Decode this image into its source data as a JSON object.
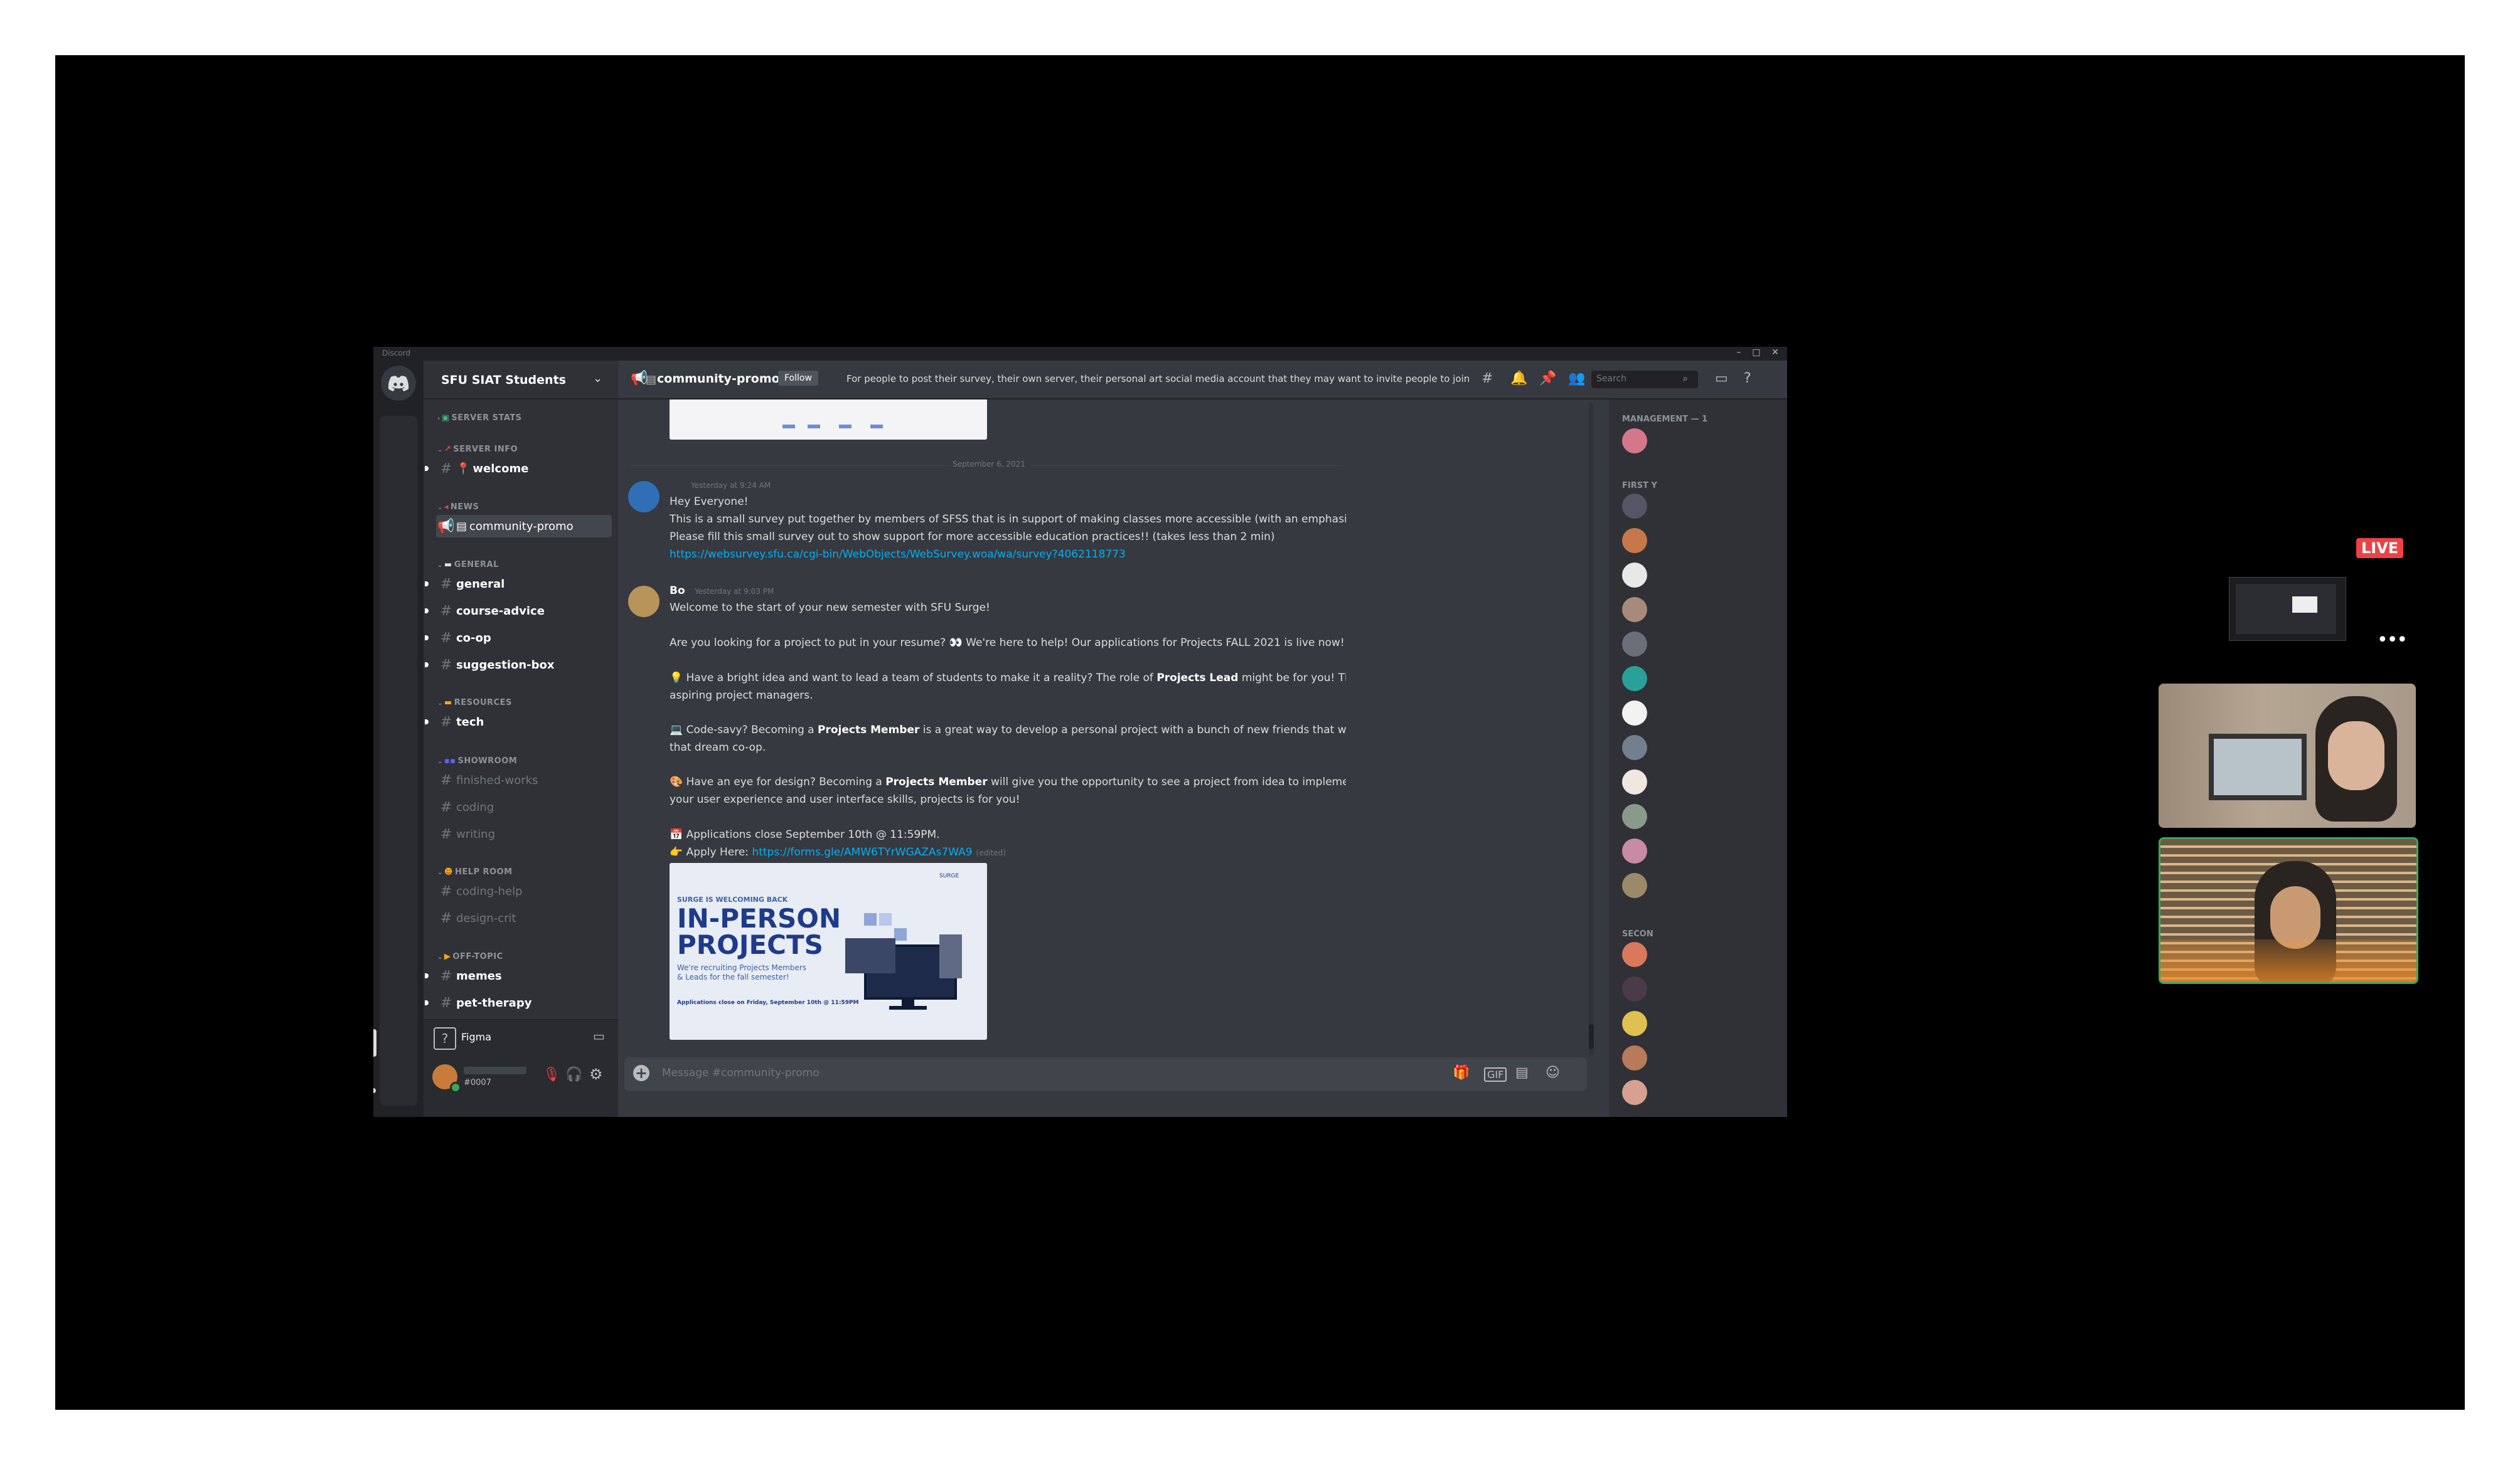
{
  "window": {
    "app_title": "Discord",
    "min": "–",
    "max": "□",
    "close": "✕"
  },
  "server": {
    "name": "SFU SIAT Students"
  },
  "categories": {
    "server_stats": "SERVER STATS",
    "server_info": "SERVER INFO",
    "news": "NEWS",
    "general": "GENERAL",
    "resources": "RESOURCES",
    "showroom": "SHOWROOM",
    "help_room": "HELP ROOM",
    "off_topic": "OFF-TOPIC"
  },
  "channels": {
    "welcome": "welcome",
    "community_promo": "community-promo",
    "general": "general",
    "course_advice": "course-advice",
    "co_op": "co-op",
    "suggestion_box": "suggestion-box",
    "tech": "tech",
    "finished_works": "finished-works",
    "coding": "coding",
    "writing": "writing",
    "coding_help": "coding-help",
    "design_crit": "design-crit",
    "memes": "memes",
    "pet_therapy": "pet-therapy"
  },
  "voice_bar": {
    "label": "Figma"
  },
  "user_bar": {
    "tag": "#0007"
  },
  "header": {
    "channel": "community-promo",
    "follow": "Follow",
    "topic": "For people to post their survey, their own server, their personal art social media account that they may want to invite people to join",
    "search_placeholder": "Search"
  },
  "messages": {
    "date_divider": "September 6, 2021",
    "m1": {
      "timestamp": "Yesterday at 9:24 AM",
      "line1": "Hey Everyone!",
      "line2": "This is a small survey put together by members of SFSS that is in support of making classes more accessible (with an emphasis on recorded lectures)",
      "line3": "Please fill this small survey out to show support for more accessible education practices!! (takes less than 2 min)",
      "link": "https://websurvey.sfu.ca/cgi-bin/WebObjects/WebSurvey.woa/wa/survey?4062118773"
    },
    "m2": {
      "author": "Bo",
      "timestamp": "Yesterday at 9:03 PM",
      "line1": "Welcome to the start of your new semester with SFU Surge!",
      "line2": "Are you looking for a project to put in your resume? 👀 We're here to help! Our applications for Projects FALL 2021 is live now!",
      "line3a": "💡 Have a bright idea and want to lead a team of students to make it a reality? The role of ",
      "line3b": "Projects Lead",
      "line3c": " might be for you! This role is great for business students, and",
      "line3d": "aspiring project managers.",
      "line4a": "💻 Code-savy? Becoming a ",
      "line4b": "Projects Member",
      "line4c": " is a great way to develop a personal project with a bunch of new friends that will boost your resume and help you land",
      "line4d": "that dream co-op.",
      "line5a": "🎨 Have an eye for design? Becoming a ",
      "line5b": "Projects Member",
      "line5c": " will give you the opportunity to see a project from idea to implementation. If you are looking to brush up on",
      "line5d": "your user experience and user interface skills, projects is for you!",
      "line6": "📅 Applications close September 10th @ 11:59PM.",
      "line7a": "👉 Apply Here: ",
      "line7_link": "https://forms.gle/AMW6TYrWGAZAs7WA9",
      "edited": "(edited)"
    },
    "promo_image": {
      "small": "SURGE IS WELCOMING BACK",
      "title1": "IN-PERSON",
      "title2": "PROJECTS",
      "sub1": "We're recruiting Projects Members",
      "sub2": "& Leads for the fall semester!",
      "foot": "Applications close on Friday, September 10th @ 11:59PM",
      "logo": "SURGE"
    }
  },
  "composer": {
    "placeholder": "Message #community-promo"
  },
  "members": {
    "management": "MANAGEMENT — 1",
    "first": "FIRST Y",
    "second": "SECON"
  },
  "stream": {
    "live": "LIVE",
    "more": "•••"
  },
  "colors": {
    "blurple": "#5865f2",
    "online": "#3ba55d",
    "idle": "#faa61a",
    "dnd": "#ed4245",
    "link": "#00b0f4"
  }
}
